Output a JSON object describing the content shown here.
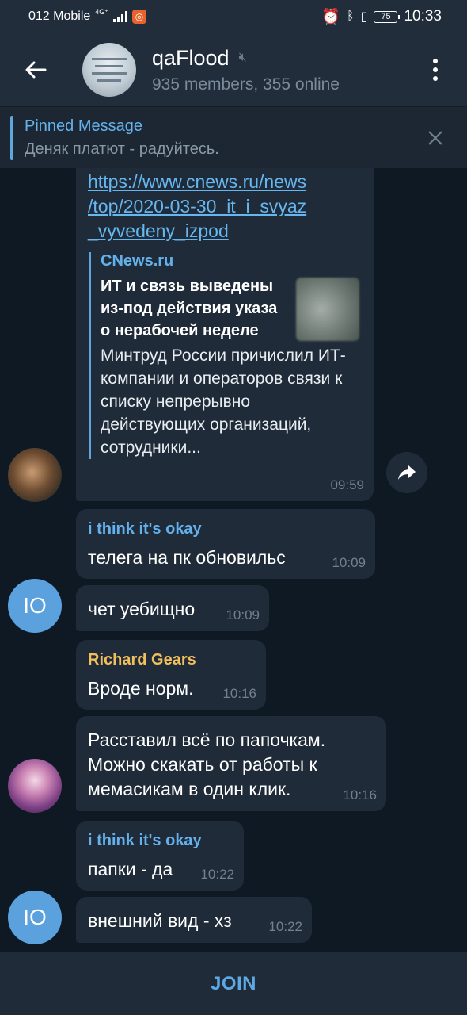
{
  "status_bar": {
    "carrier": "012 Mobile",
    "network": "4G⁺",
    "battery": "75",
    "time": "10:33"
  },
  "header": {
    "title": "qaFlood",
    "subtitle": "935 members, 355 online",
    "muted": true
  },
  "pinned": {
    "title": "Pinned Message",
    "text": "Деняк платют - радуйтесь."
  },
  "messages": [
    {
      "link_lines": [
        "https://www.cnews.ru/news",
        "/top/2020-03-30_it_i_svyaz",
        "_vyvedeny_izpod"
      ],
      "preview": {
        "site": "CNews.ru",
        "title": "ИТ и связь выведены из-под действия указа о нерабочей неделе",
        "desc": "Минтруд России причислил ИТ-компании и операторов связи к списку непрерывно действующих организаций, сотрудники..."
      },
      "time": "09:59"
    },
    {
      "sender": "i think it's okay",
      "sender_color": "#64b1eb",
      "text": "телега на пк обновильс",
      "time": "10:09"
    },
    {
      "text": "чет уебищно",
      "time": "10:09",
      "avatar_initials": "IO"
    },
    {
      "sender": "Richard Gears",
      "sender_color": "#f2bf5d",
      "text": "Вроде норм.",
      "time": "10:16"
    },
    {
      "text_lines": [
        "Расставил всё по папочкам.",
        "Можно скакать от работы к",
        "мемасикам в один клик."
      ],
      "time": "10:16"
    },
    {
      "sender": "i think it's okay",
      "sender_color": "#64b1eb",
      "text": "папки - да",
      "time": "10:22"
    },
    {
      "text": "внешний вид - хз",
      "time": "10:22",
      "avatar_initials": "IO"
    }
  ],
  "join_label": "JOIN",
  "colors": {
    "background": "#0f1923",
    "header": "#212d3b",
    "bubble": "#1f2b38",
    "link": "#66b6f0",
    "accent": "#5ea9e4"
  }
}
